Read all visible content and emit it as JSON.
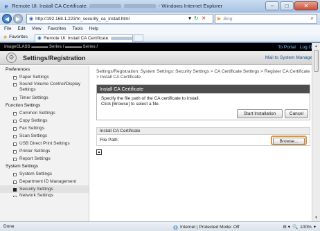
{
  "window": {
    "title_prefix": "Remote UI: Install CA Certificate:",
    "title_suffix": "- Windows Internet Explorer",
    "minimize": "–",
    "maximize": "□",
    "close": "✕"
  },
  "address": {
    "url": "http://192.168.1.223/m_security_ca_install.html",
    "search_placeholder": "Bing"
  },
  "menu": [
    "File",
    "Edit",
    "View",
    "Favorites",
    "Tools",
    "Help"
  ],
  "favorites": {
    "label": "Favorites",
    "tab_title": "Remote UI: Install CA Certificate:"
  },
  "header": {
    "to_portal": "To Portal",
    "log_out": "Log Out",
    "page_title": "Settings/Registration",
    "mail": "Mail to System Manager"
  },
  "sidebar": {
    "items": [
      {
        "label": "Preferences",
        "type": "section"
      },
      {
        "label": "Paper Settings",
        "type": "sub"
      },
      {
        "label": "Sound Volume Control/Display Settings",
        "type": "sub"
      },
      {
        "label": "Timer Settings",
        "type": "sub"
      },
      {
        "label": "Function Settings",
        "type": "section"
      },
      {
        "label": "Common Settings",
        "type": "sub"
      },
      {
        "label": "Copy Settings",
        "type": "sub"
      },
      {
        "label": "Fax Settings",
        "type": "sub"
      },
      {
        "label": "Scan Settings",
        "type": "sub"
      },
      {
        "label": "USB Direct Print Settings",
        "type": "sub"
      },
      {
        "label": "Printer Settings",
        "type": "sub"
      },
      {
        "label": "Report Settings",
        "type": "sub"
      },
      {
        "label": "System Settings",
        "type": "section"
      },
      {
        "label": "System Settings",
        "type": "sub"
      },
      {
        "label": "Department ID Management",
        "type": "sub"
      },
      {
        "label": "Security Settings",
        "type": "sub"
      },
      {
        "label": "Network Settings",
        "type": "sub"
      }
    ]
  },
  "main": {
    "breadcrumb": "Settings/Registration: System Settings: Security Settings > CA Certificate Settings > Register CA Certificate > Install CA Certificate",
    "box1": {
      "title": "Install CA Certificate",
      "line1": "Specify the file path of the CA certificate to install.",
      "line2": "Click [Browse] to select a file.",
      "start_button": "Start Installation",
      "cancel_button": "Cancel"
    },
    "box2": {
      "title": "Install CA Certificate",
      "file_path_label": "File Path:",
      "browse_button": "Browse..."
    },
    "page_top_icon": "▲"
  },
  "status": {
    "left": "Done",
    "zone": "Internet | Protected Mode: Off",
    "zoom": "100%"
  }
}
